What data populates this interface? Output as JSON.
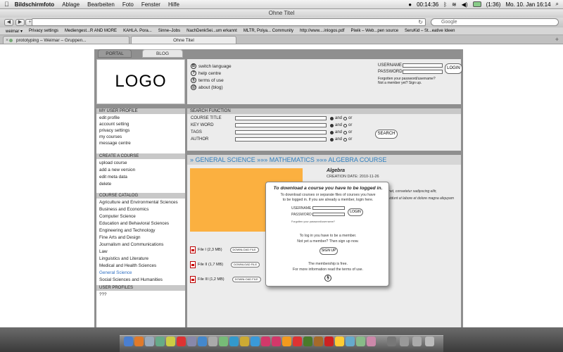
{
  "menubar": {
    "apple": "",
    "items": [
      "Bildschirmfoto",
      "Ablage",
      "Bearbeiten",
      "Foto",
      "Fenster",
      "Hilfe"
    ],
    "status": {
      "time_elapsed": "00:14:36",
      "battery": "(1:36)",
      "datetime": "Mo. 10. Jan  16:14"
    }
  },
  "browser": {
    "window_title": "Ohne Titel",
    "url": "",
    "search_placeholder": "Google",
    "bookmarks": [
      "weimar ▾",
      "Privacy settings",
      "Mediengest...R AND MORE",
      "KAHLA. Pora...",
      "Sinne–Jobs",
      "NachDenkSei...um erkannt",
      "MLTR, Polya... Community",
      "http://www....inlogos.pdf",
      "Piwik – Web...pen source",
      "SeruKid – St...eative Ideen"
    ],
    "tabs": [
      {
        "label": "prototyping – Weimar – Gruppen..."
      },
      {
        "label": "Ohne Titel"
      }
    ]
  },
  "site": {
    "tabs": {
      "portal": "PORTAL",
      "blog": "BLOG"
    },
    "logo": "LOGO",
    "top_links": [
      {
        "icon": "B",
        "label": "switch language"
      },
      {
        "icon": "?",
        "label": "help centre"
      },
      {
        "icon": "§",
        "label": "terms of use"
      },
      {
        "icon": "@",
        "label": "about (blog)"
      }
    ],
    "login": {
      "username_label": "USERNAME",
      "password_label": "PASSWORD",
      "button": "LOGIN",
      "forgot": "Forgotten your password/username?",
      "signup": "Not a member yet? Sign up."
    },
    "user_profile": {
      "heading": "MY USER PROFILE",
      "items": [
        "edit profile",
        "account setting",
        "privacy settings",
        "my courses",
        "message centre"
      ]
    },
    "create_course": {
      "heading": "CREATE A COURSE",
      "items": [
        "upload course",
        "add a new version",
        "edit meta data",
        "delete"
      ]
    },
    "catalog": {
      "heading": "COURSE CATALOG",
      "items": [
        "Agriculture and Environmental Sciences",
        "Business and Economics",
        "Computer Science",
        "Education and Behavioral Sciences",
        "Engineering and Technology",
        "Fine Arts and Design",
        "Journalism and Communications",
        "Law",
        "Linguistics and Literature",
        "Medical and Health Sciences",
        "General Science",
        "Social Sciences and Humanities"
      ]
    },
    "user_profiles": {
      "heading": "USER PROFILES",
      "value": "???"
    },
    "search": {
      "heading": "SEARCH FUNCTION",
      "fields": [
        "COURSE TITLE",
        "KEY WORD",
        "TAGS",
        "AUTHOR"
      ],
      "and_label": "and",
      "or_label": "or",
      "button": "SEARCH"
    },
    "breadcrumb": "» GENERAL SCIENCE »»» MATHEMATICS »»» ALGEBRA COURSE",
    "course": {
      "title": "Algebra",
      "creation": "CREATION DATE: 2010-11-26",
      "lorem1": "amet, consetetur sadipscing elitr,",
      "lorem2": "invidunt ut labore et dolore magna aliquyam",
      "files": [
        {
          "label": "File I (2,3 MB)"
        },
        {
          "label": "File II (1,7 MB)"
        },
        {
          "label": "File III (1,2 MB)"
        }
      ],
      "download_label": "DOWNLOAD FILE"
    },
    "modal": {
      "title": "To download a course you have to be logged in.",
      "text1": "To download courses or separate files of courses you have",
      "text2": "to be logged in. If you are already a member, login here.",
      "username_label": "USERNAME",
      "password_label": "PASSWORD",
      "login_button": "LOGIN",
      "forgot": "Forgotten your password/username?",
      "text3": "To log in you have to be a member.",
      "text4": "Not yet a member? Then sign up now.",
      "signup_button": "SIGN UP",
      "text5": "The membership is free.",
      "text6": "For more information read the terms of use.",
      "icon": "§"
    }
  },
  "colors": {
    "accent": "#2f7fbf",
    "orange": "#fbb040",
    "frame": "#8f8f8f"
  }
}
